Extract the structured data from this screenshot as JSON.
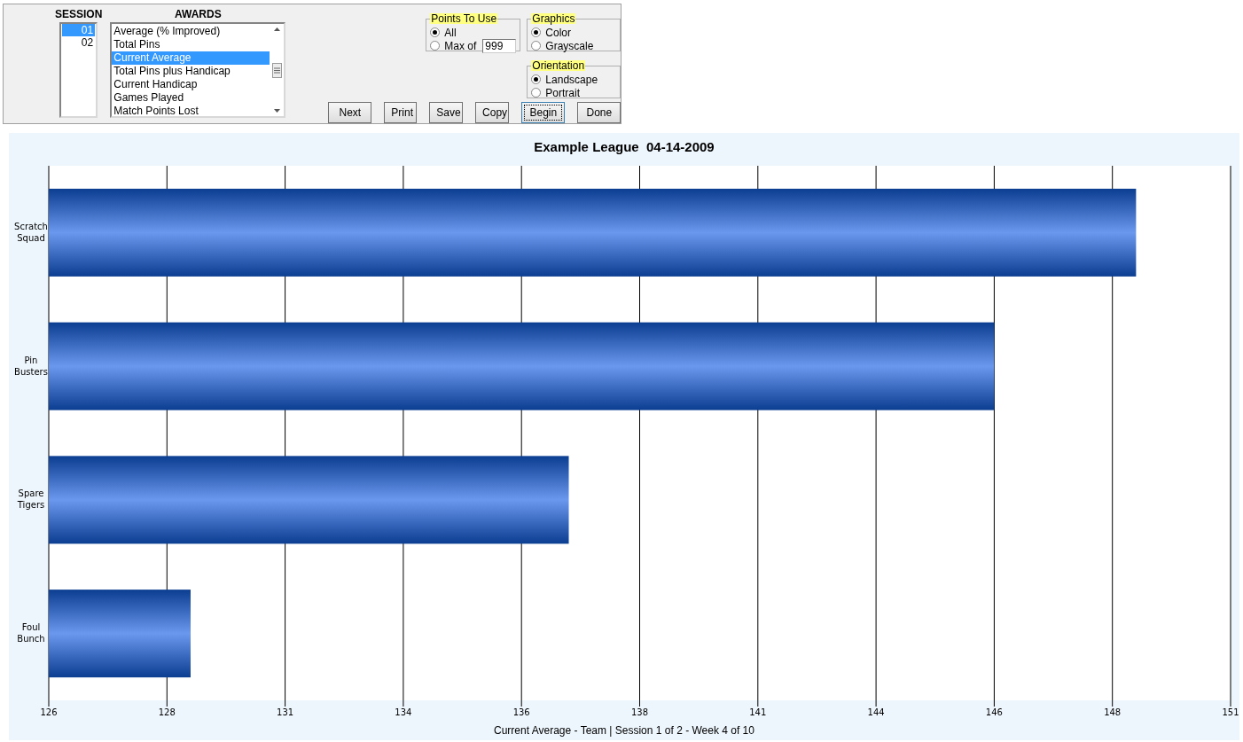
{
  "toolbar": {
    "session": {
      "label": "SESSION",
      "items": [
        {
          "text": "01",
          "selected": true
        },
        {
          "text": "02",
          "selected": false
        }
      ]
    },
    "awards": {
      "label": "AWARDS",
      "items": [
        {
          "text": "Average (% Improved)",
          "selected": false
        },
        {
          "text": "Total Pins",
          "selected": false
        },
        {
          "text": "Current Average",
          "selected": true
        },
        {
          "text": "Total Pins plus Handicap",
          "selected": false
        },
        {
          "text": "Current Handicap",
          "selected": false
        },
        {
          "text": "Games Played",
          "selected": false
        },
        {
          "text": "Match Points Lost",
          "selected": false
        }
      ]
    },
    "points_to_use": {
      "title": "Points To Use",
      "options": [
        {
          "label": "All",
          "selected": true
        },
        {
          "label": "Max of",
          "selected": false
        }
      ],
      "max_value": "999"
    },
    "graphics": {
      "title": "Graphics",
      "options": [
        {
          "label": "Color",
          "selected": true
        },
        {
          "label": "Grayscale",
          "selected": false
        }
      ]
    },
    "orientation": {
      "title": "Orientation",
      "options": [
        {
          "label": "Landscape",
          "selected": true
        },
        {
          "label": "Portrait",
          "selected": false
        }
      ]
    },
    "buttons": [
      {
        "label": "Next",
        "focused": false
      },
      {
        "label": "Print",
        "focused": false
      },
      {
        "label": "Save",
        "focused": false
      },
      {
        "label": "Copy",
        "focused": false
      },
      {
        "label": "Begin",
        "focused": true
      },
      {
        "label": "Done",
        "focused": false
      }
    ]
  },
  "chart": {
    "title": "Example League  04-14-2009",
    "footer": "Current Average - Team | Session 1 of 2 - Week 4 of 10",
    "chart_data": {
      "type": "bar",
      "orientation": "horizontal",
      "categories": [
        "Scratch Squad",
        "Pin Busters",
        "Spare Tigers",
        "Foul Bunch"
      ],
      "series": [
        {
          "color": "#6a98ee",
          "values": [
            149,
            146,
            137,
            129
          ]
        }
      ],
      "grid": true,
      "xlim": [
        126,
        151
      ],
      "xticks": [
        126,
        {
          "value": 128.5,
          "label": "128"
        },
        131,
        {
          "value": 133.5,
          "label": "134"
        },
        136,
        {
          "value": 138.5,
          "label": "138"
        },
        141,
        {
          "value": 143.5,
          "label": "144"
        },
        146,
        {
          "value": 148.5,
          "label": "148"
        },
        151
      ]
    }
  }
}
